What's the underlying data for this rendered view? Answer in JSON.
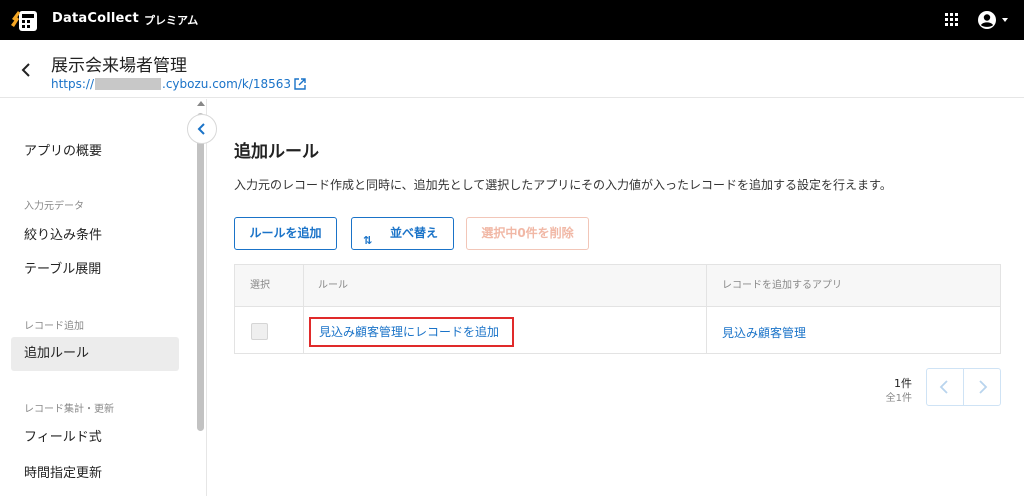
{
  "topbar": {
    "brand": "DataCollect",
    "plan": "プレミアム",
    "logo_icon": "datacollect-logo",
    "apps_icon": "grid-icon",
    "user_icon": "user-account-icon"
  },
  "app": {
    "title": "展示会来場者管理",
    "url_prefix": "https://",
    "url_suffix": ".cybozu.com/k/18563",
    "external_icon": "external-link-icon"
  },
  "sidebar": {
    "items": [
      {
        "label": "アプリの概要"
      },
      {
        "section": "入力元データ"
      },
      {
        "label": "絞り込み条件"
      },
      {
        "label": "テーブル展開"
      },
      {
        "section": "レコード追加"
      },
      {
        "label": "追加ルール",
        "active": true
      },
      {
        "section": "レコード集計・更新"
      },
      {
        "label": "フィールド式"
      },
      {
        "label": "時間指定更新"
      }
    ]
  },
  "main": {
    "title": "追加ルール",
    "description": "入力元のレコード作成と同時に、追加先として選択したアプリにその入力値が入ったレコードを追加する設定を行えます。",
    "buttons": {
      "add_rule": "ルールを追加",
      "sort_icon": "⇅",
      "sort": "並べ替え",
      "delete_selected": "選択中0件を削除"
    },
    "table": {
      "headers": [
        "選択",
        "ルール",
        "レコードを追加するアプリ"
      ],
      "rows": [
        {
          "rule": "見込み顧客管理にレコードを追加",
          "target_app": "見込み顧客管理",
          "selected": false
        }
      ]
    },
    "pagination": {
      "count": "1件",
      "total": "全1件"
    }
  },
  "colors": {
    "accent": "#1a73c8",
    "highlight": "#e02a2a",
    "disabled": "#f1b8a6"
  }
}
